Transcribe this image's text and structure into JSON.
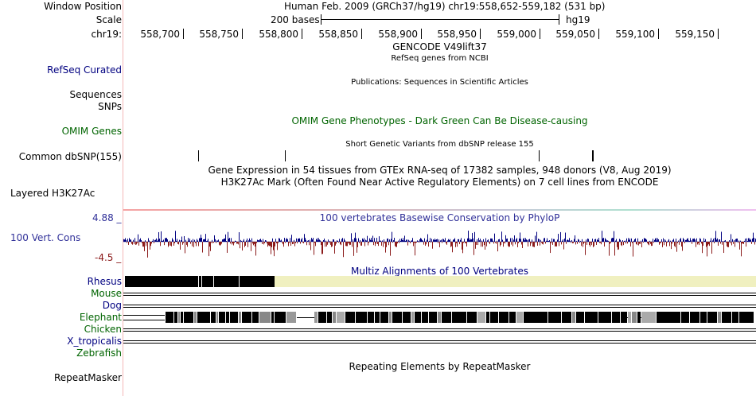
{
  "header": {
    "window_position_label": "Window Position",
    "window_position_text": "Human Feb. 2009 (GRCh37/hg19)   chr19:558,652-559,182 (531 bp)",
    "scale_label": "Scale",
    "scale_text": "200 bases",
    "scale_assembly": "hg19",
    "chrom_label": "chr19:",
    "ruler_ticks": [
      "558,700",
      "558,750",
      "558,800",
      "558,850",
      "558,900",
      "558,950",
      "559,000",
      "559,050",
      "559,100",
      "559,150"
    ]
  },
  "tracks": {
    "gencode_title": "GENCODE V49lift37",
    "refseq_subtitle": "RefSeq genes from NCBI",
    "refseq_label": "RefSeq Curated",
    "publications_title": "Publications: Sequences in Scientific Articles",
    "sequences_label": "Sequences",
    "snps_label": "SNPs",
    "omim_label": "OMIM Genes",
    "omim_title": "OMIM Gene Phenotypes - Dark Green Can Be Disease-causing",
    "snp155_title": "Short Genetic Variants from dbSNP release 155",
    "snp155_label": "Common dbSNP(155)",
    "gtex_title": "Gene Expression in 54 tissues from GTEx RNA-seq of 17382 samples, 948 donors (V8, Aug 2019)",
    "h3k27ac_title": "H3K27Ac Mark (Often Found Near Active Regulatory Elements) on 7 cell lines from ENCODE",
    "h3k27ac_label": "Layered H3K27Ac",
    "cons_max": "4.88 _",
    "cons_title": "100 vertebrates Basewise Conservation by PhyloP",
    "cons_label": "100 Vert. Cons",
    "cons_min": "-4.5 _",
    "multiz_title": "Multiz Alignments of 100 Vertebrates",
    "species": [
      {
        "name": "Rhesus",
        "color": "navy"
      },
      {
        "name": "Mouse",
        "color": "green"
      },
      {
        "name": "Dog",
        "color": "navy"
      },
      {
        "name": "Elephant",
        "color": "green"
      },
      {
        "name": "Chicken",
        "color": "green"
      },
      {
        "name": "X_tropicalis",
        "color": "navy"
      },
      {
        "name": "Zebrafish",
        "color": "green"
      }
    ],
    "repeat_title": "Repeating Elements by RepeatMasker",
    "repeat_label": "RepeatMasker"
  },
  "colors": {
    "conservation_positive": "#000080",
    "conservation_negative": "#8b1a1a",
    "rhesus_gap_fill": "#f0f0c0",
    "divider": "#f4b8b8"
  }
}
